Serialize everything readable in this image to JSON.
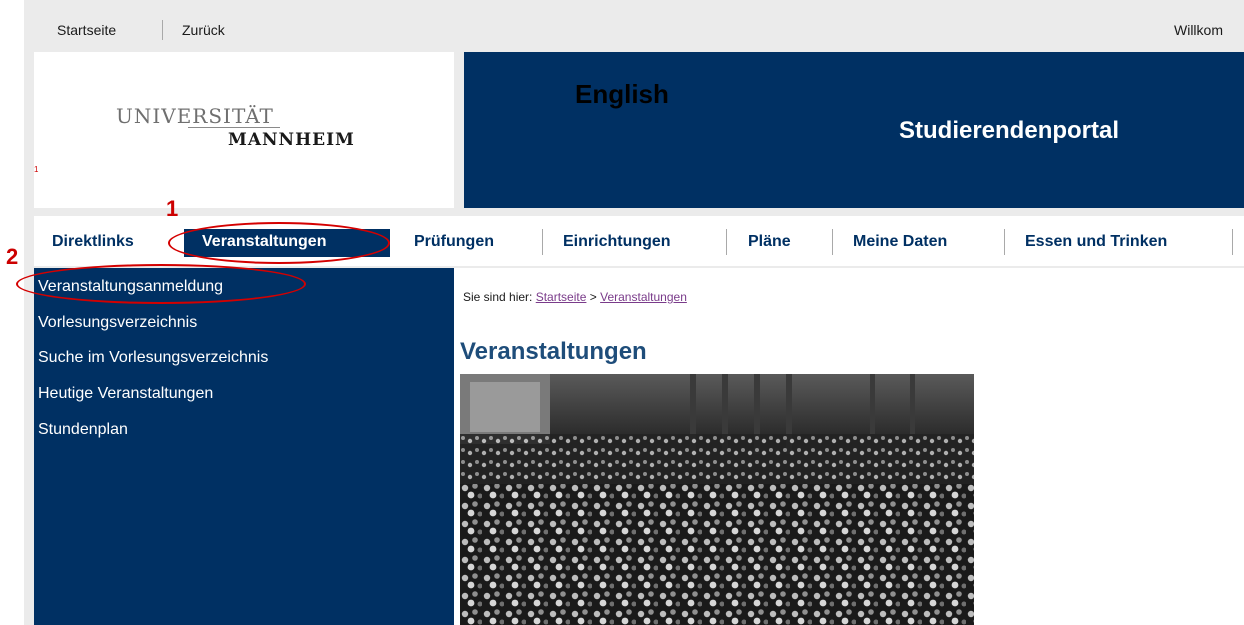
{
  "topbar": {
    "home": "Startseite",
    "back": "Zurück",
    "welcome": "Willkom"
  },
  "logo": {
    "line1": "UNIVERSITÄT",
    "line2": "MANNHEIM",
    "mark": "1"
  },
  "banner": {
    "language_link": "English",
    "portal_title": "Studierendenportal",
    "color": "#003063"
  },
  "nav": {
    "items": [
      "Direktlinks",
      "Veranstaltungen",
      "Prüfungen",
      "Einrichtungen",
      "Pläne",
      "Meine Daten",
      "Essen und Trinken"
    ],
    "active": "Veranstaltungen"
  },
  "sidebar": {
    "items": [
      "Veranstaltungsanmeldung",
      "Vorlesungsverzeichnis",
      "Suche im Vorlesungsverzeichnis",
      "Heutige Veranstaltungen",
      "Stundenplan"
    ]
  },
  "content": {
    "breadcrumb_prefix": "Sie sind hier:",
    "breadcrumb_home": "Startseite",
    "breadcrumb_sep": ">",
    "breadcrumb_current": "Veranstaltungen",
    "heading": "Veranstaltungen",
    "image": "lecture-hall-photo"
  },
  "annotations": {
    "step1": "1",
    "step2": "2",
    "color": "#d40000"
  }
}
